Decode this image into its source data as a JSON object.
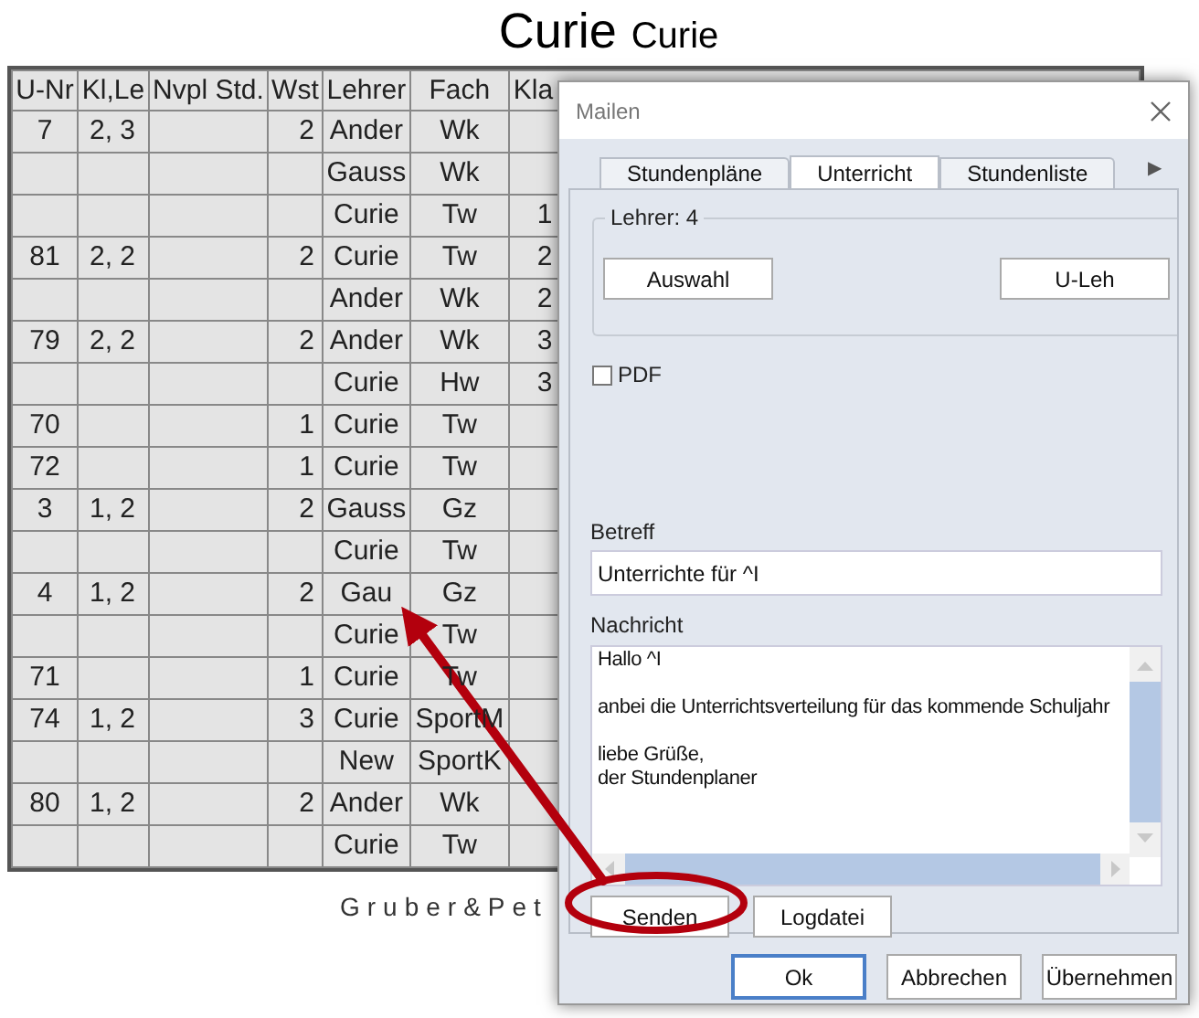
{
  "title": {
    "main": "Curie",
    "sub": "Curie"
  },
  "table": {
    "columns": [
      "U-Nr",
      "Kl,Le",
      "Nvpl Std.",
      "Wst",
      "Lehrer",
      "Fach",
      "Kla"
    ],
    "rows": [
      {
        "u_nr": "7",
        "kl_le": "2, 3",
        "wst": "2",
        "lehrer": "Ander",
        "fach": "Wk"
      },
      {
        "lehrer": "Gauss",
        "fach": "Wk"
      },
      {
        "lehrer": "Curie",
        "fach": "Tw",
        "klasse": "1"
      },
      {
        "u_nr": "81",
        "kl_le": "2, 2",
        "wst": "2",
        "lehrer": "Curie",
        "fach": "Tw",
        "klasse": "2"
      },
      {
        "lehrer": "Ander",
        "fach": "Wk",
        "klasse": "2"
      },
      {
        "u_nr": "79",
        "kl_le": "2, 2",
        "wst": "2",
        "lehrer": "Ander",
        "fach": "Wk",
        "klasse": "3"
      },
      {
        "lehrer": "Curie",
        "fach": "Hw",
        "klasse": "3"
      },
      {
        "u_nr": "70",
        "wst": "1",
        "lehrer": "Curie",
        "fach": "Tw"
      },
      {
        "u_nr": "72",
        "wst": "1",
        "lehrer": "Curie",
        "fach": "Tw"
      },
      {
        "u_nr": "3",
        "kl_le": "1, 2",
        "wst": "2",
        "lehrer": "Gauss",
        "fach": "Gz"
      },
      {
        "lehrer": "Curie",
        "fach": "Tw"
      },
      {
        "u_nr": "4",
        "kl_le": "1, 2",
        "wst": "2",
        "lehrer": "Gau",
        "fach": "Gz"
      },
      {
        "lehrer": "Curie",
        "fach": "Tw"
      },
      {
        "u_nr": "71",
        "wst": "1",
        "lehrer": "Curie",
        "fach": "Tw"
      },
      {
        "u_nr": "74",
        "kl_le": "1, 2",
        "wst": "3",
        "lehrer": "Curie",
        "fach": "SportM"
      },
      {
        "lehrer": "New",
        "fach": "SportK"
      },
      {
        "u_nr": "80",
        "kl_le": "1, 2",
        "wst": "2",
        "lehrer": "Ander",
        "fach": "Wk"
      },
      {
        "lehrer": "Curie",
        "fach": "Tw"
      }
    ]
  },
  "footer": "Gruber&Pet",
  "dialog": {
    "title": "Mailen",
    "tabs": [
      {
        "label": "Stundenpläne",
        "selected": false
      },
      {
        "label": "Unterricht",
        "selected": true
      },
      {
        "label": "Stundenliste",
        "selected": false
      }
    ],
    "tab_scroll": "▶",
    "group": {
      "label": "Lehrer: 4",
      "buttons": [
        "Auswahl",
        "U-Leh"
      ]
    },
    "pdf": {
      "label": "PDF",
      "checked": false
    },
    "subject": {
      "label": "Betreff",
      "value": "Unterrichte für ^I"
    },
    "message": {
      "label": "Nachricht",
      "paragraphs": [
        [
          "Hallo ^I"
        ],
        [
          "anbei die Unterrichtsverteilung für das kommende Schuljahr"
        ],
        [
          "liebe Grüße,",
          "der Stundenplaner"
        ]
      ]
    },
    "actions": [
      {
        "label": "Senden",
        "highlighted": true
      },
      {
        "label": "Logdatei",
        "highlighted": false
      }
    ],
    "footer_buttons": [
      {
        "label": "Ok",
        "default": true
      },
      {
        "label": "Abbrechen",
        "default": false
      },
      {
        "label": "Übernehmen",
        "default": false
      }
    ]
  }
}
